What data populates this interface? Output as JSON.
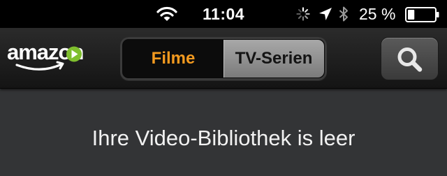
{
  "status_bar": {
    "time": "11:04",
    "battery_percent": "25 %",
    "battery_level": 0.25,
    "icons": [
      "wifi-icon",
      "activity-spinner-icon",
      "location-arrow-icon",
      "bluetooth-icon",
      "battery-icon"
    ]
  },
  "nav": {
    "logo_text": "amazon",
    "segments": {
      "filme": "Filme",
      "tv_serien": "TV-Serien"
    },
    "selected_segment": "Filme",
    "search_icon": "magnifier-icon"
  },
  "colors": {
    "accent": "#f39a1f",
    "background": "#333436",
    "nav_background": "#1b1b1b"
  },
  "content": {
    "empty_message": "Ihre Video-Bibliothek is leer"
  }
}
